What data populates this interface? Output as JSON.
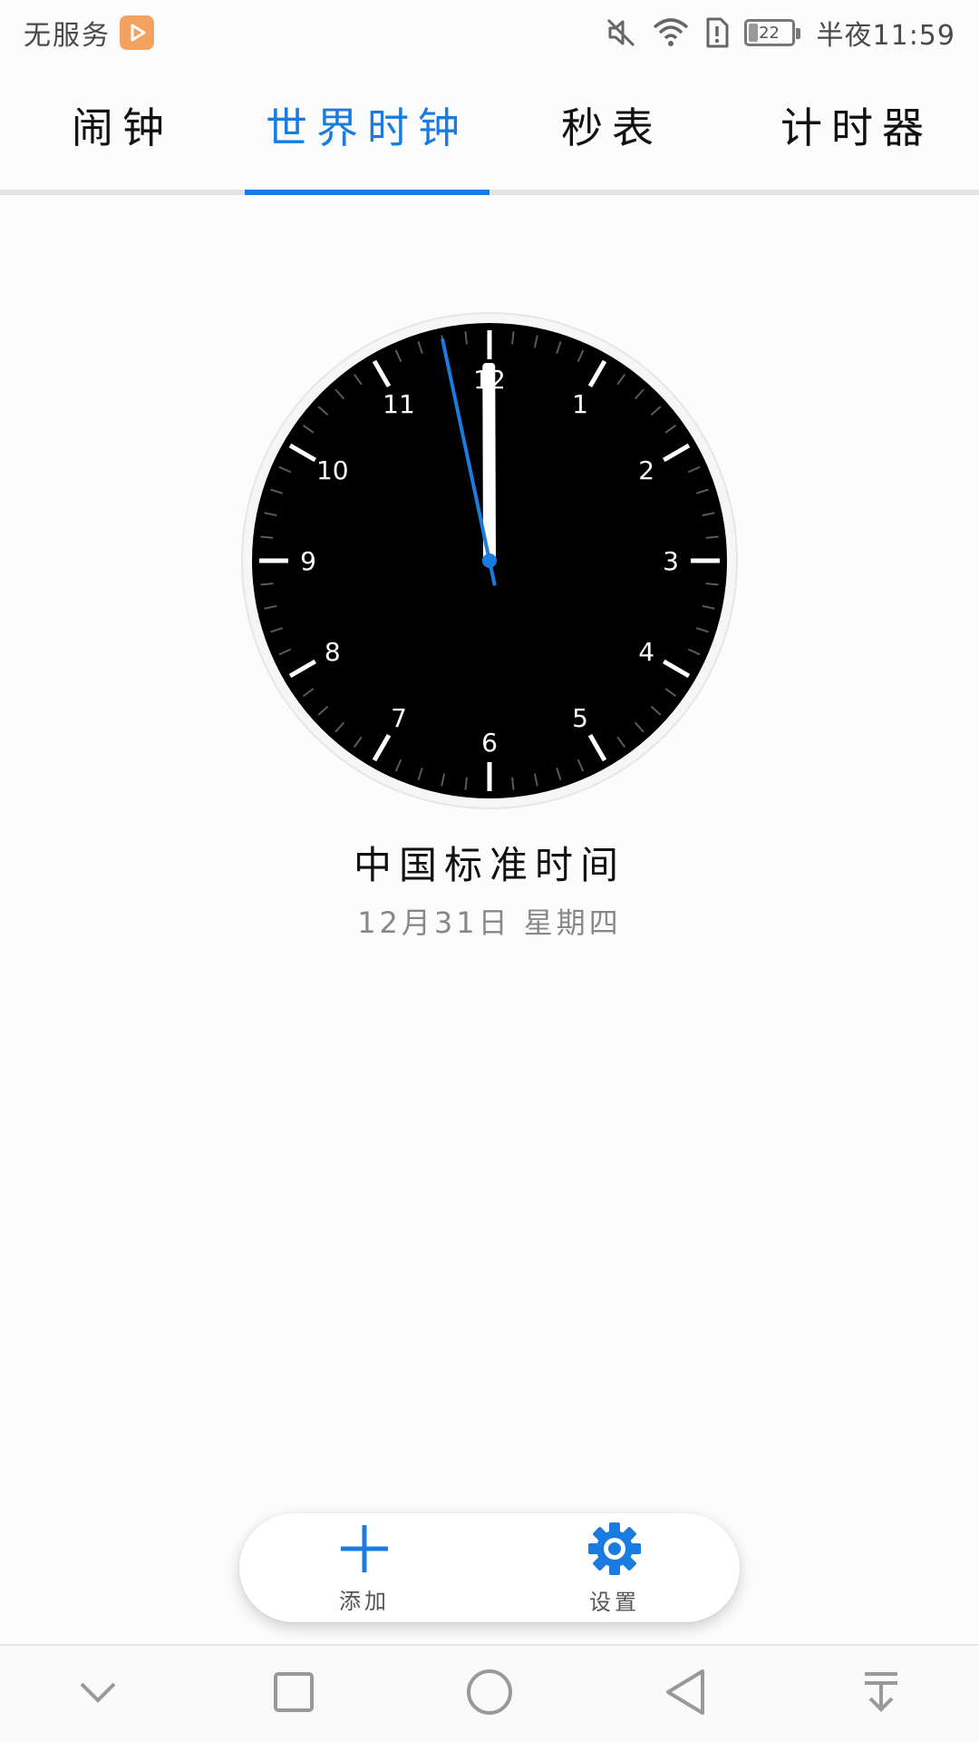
{
  "status_bar": {
    "carrier": "无服务",
    "battery_level": "22",
    "time": "半夜11:59"
  },
  "tabs": [
    {
      "label": "闹钟",
      "active": false
    },
    {
      "label": "世界时钟",
      "active": true
    },
    {
      "label": "秒表",
      "active": false
    },
    {
      "label": "计时器",
      "active": false
    }
  ],
  "clock": {
    "hour_numbers": [
      "12",
      "1",
      "2",
      "3",
      "4",
      "5",
      "6",
      "7",
      "8",
      "9",
      "10",
      "11"
    ],
    "time": {
      "hour": 11,
      "minute": 59,
      "second": 58
    },
    "accent_color": "#1a7ce0",
    "face_color": "#000000"
  },
  "city": {
    "name": "中国标准时间",
    "date": "12月31日 星期四"
  },
  "actions": {
    "add_label": "添加",
    "settings_label": "设置"
  },
  "colors": {
    "accent": "#1a7ce0",
    "badge": "#f3a25f"
  }
}
